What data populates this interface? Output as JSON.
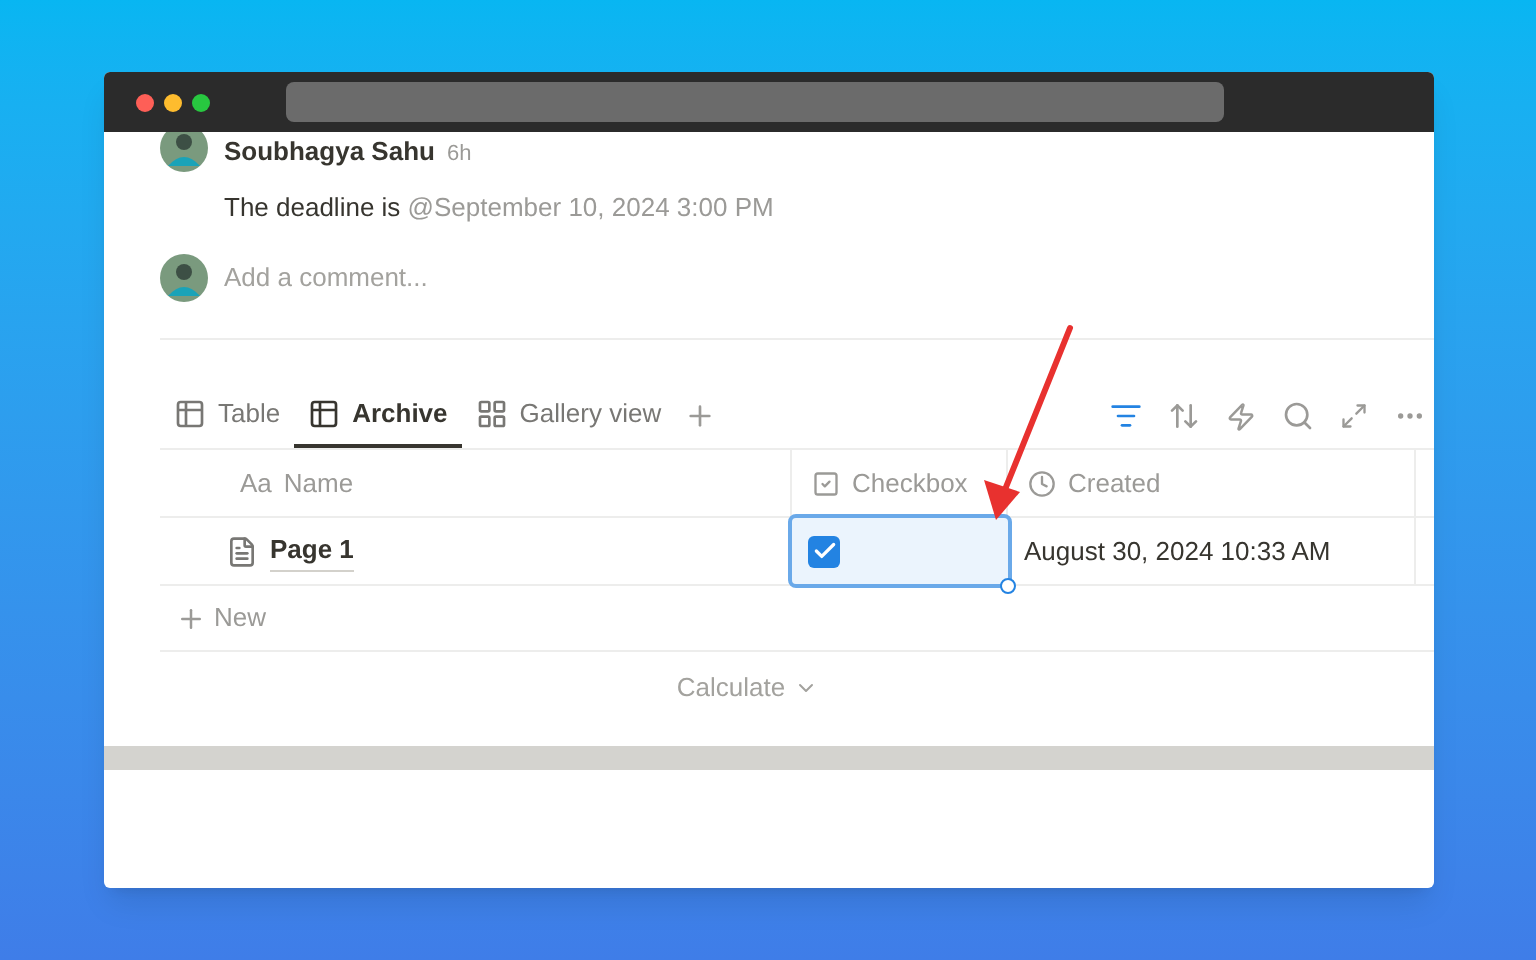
{
  "comment": {
    "author": "Soubhagya Sahu",
    "time": "6h",
    "text": "The deadline is",
    "mention": "@September 10, 2024 3:00 PM"
  },
  "new_comment": {
    "placeholder": "Add a comment..."
  },
  "views": [
    {
      "label": "Table",
      "kind": "table",
      "selected": false
    },
    {
      "label": "Archive",
      "kind": "table",
      "selected": true
    },
    {
      "label": "Gallery view",
      "kind": "gallery",
      "selected": false
    }
  ],
  "table": {
    "columns": [
      {
        "label": "Name",
        "kind": "title",
        "prefix": "Aa"
      },
      {
        "label": "Checkbox",
        "kind": "checkbox"
      },
      {
        "label": "Created",
        "kind": "created"
      }
    ],
    "rows": [
      {
        "name": "Page 1",
        "checked": true,
        "created": "August 30, 2024 10:33 AM",
        "selected": true
      }
    ]
  },
  "new_row": "New",
  "calculate": "Calculate"
}
